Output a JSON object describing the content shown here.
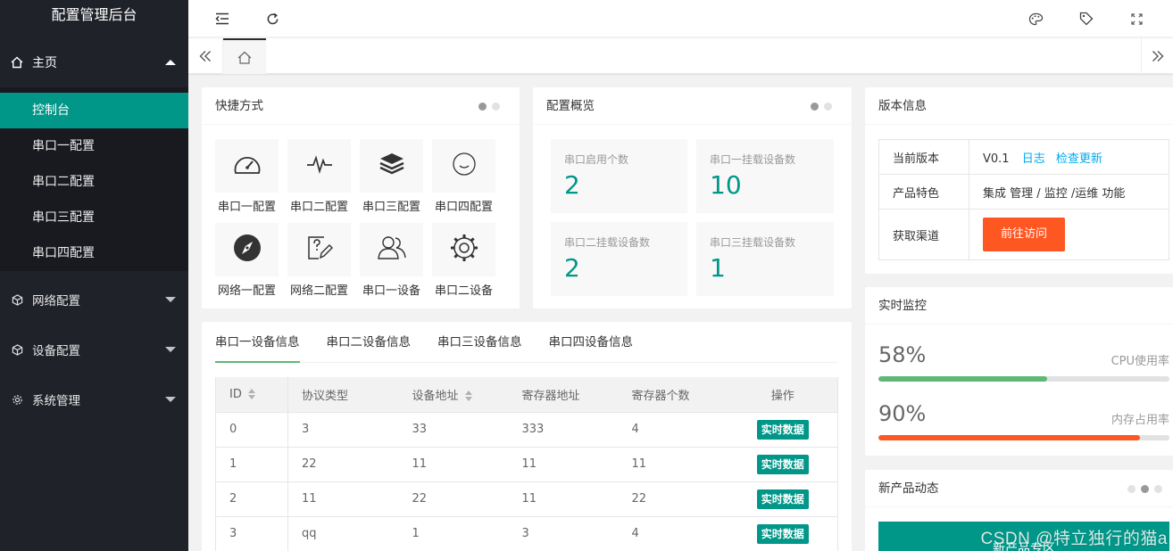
{
  "app": {
    "title": "配置管理后台"
  },
  "sidebar": {
    "home": {
      "label": "主页",
      "items": [
        "控制台",
        "串口一配置",
        "串口二配置",
        "串口三配置",
        "串口四配置"
      ]
    },
    "groups": [
      "网络配置",
      "设备配置",
      "系统管理"
    ]
  },
  "shortcuts": {
    "title": "快捷方式",
    "items": [
      {
        "label": "串口一配置",
        "icon": "gauge-icon"
      },
      {
        "label": "串口二配置",
        "icon": "pulse-icon"
      },
      {
        "label": "串口三配置",
        "icon": "layers-icon"
      },
      {
        "label": "串口四配置",
        "icon": "smile-icon"
      },
      {
        "label": "网络一配置",
        "icon": "compass-icon"
      },
      {
        "label": "网络二配置",
        "icon": "help-edit-icon"
      },
      {
        "label": "串口一设备",
        "icon": "users-icon"
      },
      {
        "label": "串口二设备",
        "icon": "gear-icon"
      }
    ]
  },
  "overview": {
    "title": "配置概览",
    "stats": [
      {
        "label": "串口启用个数",
        "value": "2"
      },
      {
        "label": "串口一挂载设备数",
        "value": "10"
      },
      {
        "label": "串口二挂载设备数",
        "value": "2"
      },
      {
        "label": "串口三挂载设备数",
        "value": "1"
      }
    ]
  },
  "version": {
    "title": "版本信息",
    "rows": {
      "current_label": "当前版本",
      "current_value": "V0.1",
      "log_link": "日志",
      "update_link": "检查更新",
      "feature_label": "产品特色",
      "feature_value": "集成 管理 / 监控 /运维 功能",
      "channel_label": "获取渠道",
      "visit_button": "前往访问"
    }
  },
  "monitor": {
    "title": "实时监控",
    "cpu": {
      "percent_text": "58%",
      "label": "CPU使用率",
      "fraction": 0.58,
      "color": "#5fb878"
    },
    "mem": {
      "percent_text": "90%",
      "label": "内存占用率",
      "fraction": 0.9,
      "color": "#ff5722"
    }
  },
  "news": {
    "title": "新产品动态",
    "banner": "新产品专区"
  },
  "device_tabs": {
    "tabs": [
      "串口一设备信息",
      "串口二设备信息",
      "串口三设备信息",
      "串口四设备信息"
    ],
    "columns": [
      "ID",
      "协议类型",
      "设备地址",
      "寄存器地址",
      "寄存器个数",
      "操作"
    ],
    "rows": [
      [
        "0",
        "3",
        "33",
        "333",
        "4"
      ],
      [
        "1",
        "22",
        "11",
        "11",
        "11"
      ],
      [
        "2",
        "11",
        "22",
        "11",
        "22"
      ],
      [
        "3",
        "qq",
        "1",
        "3",
        "4"
      ]
    ],
    "action_label": "实时数据"
  },
  "watermark": "CSDN @特立独行的猫a",
  "colors": {
    "accent": "#009688",
    "sidebar": "#20222a",
    "danger": "#ff5722",
    "link": "#01aaed"
  }
}
